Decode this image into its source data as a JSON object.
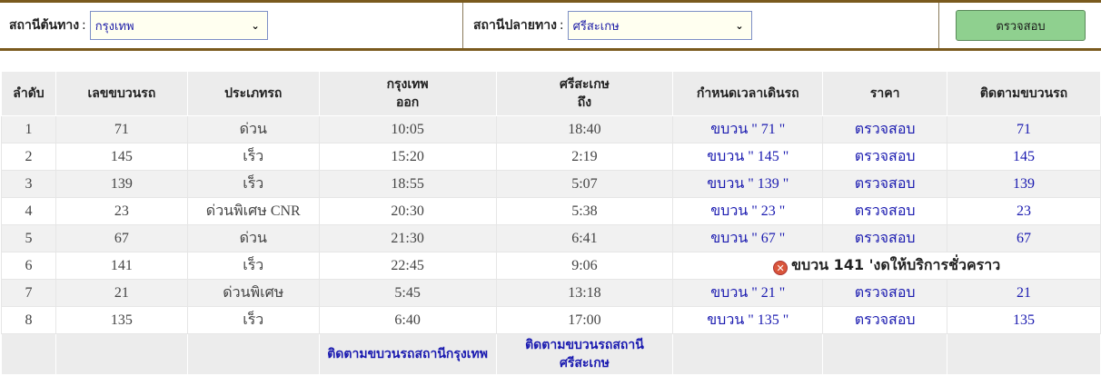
{
  "search": {
    "origin_label": "สถานีต้นทาง",
    "origin_value": "กรุงเทพ",
    "destination_label": "สถานีปลายทาง",
    "destination_value": "ศรีสะเกษ",
    "colon": ":",
    "check_button": "ตรวจสอบ"
  },
  "table": {
    "headers": {
      "seq": "ลำดับ",
      "train_no": "เลขขบวนรถ",
      "type": "ประเภทรถ",
      "depart_station": "กรุงเทพ",
      "depart_word": "ออก",
      "arrive_station": "ศรีสะเกษ",
      "arrive_word": "ถึง",
      "timetable": "กำหนดเวลาเดินรถ",
      "price": "ราคา",
      "track": "ติดตามขบวนรถ"
    },
    "rows": [
      {
        "seq": "1",
        "train_no": "71",
        "type": "ด่วน",
        "depart": "10:05",
        "arrive": "18:40",
        "timetable": "ขบวน \" 71 \"",
        "price": "ตรวจสอบ",
        "track": "71"
      },
      {
        "seq": "2",
        "train_no": "145",
        "type": "เร็ว",
        "depart": "15:20",
        "arrive": "2:19",
        "timetable": "ขบวน \" 145 \"",
        "price": "ตรวจสอบ",
        "track": "145"
      },
      {
        "seq": "3",
        "train_no": "139",
        "type": "เร็ว",
        "depart": "18:55",
        "arrive": "5:07",
        "timetable": "ขบวน \" 139 \"",
        "price": "ตรวจสอบ",
        "track": "139"
      },
      {
        "seq": "4",
        "train_no": "23",
        "type": "ด่วนพิเศษ CNR",
        "depart": "20:30",
        "arrive": "5:38",
        "timetable": "ขบวน \" 23 \"",
        "price": "ตรวจสอบ",
        "track": "23"
      },
      {
        "seq": "5",
        "train_no": "67",
        "type": "ด่วน",
        "depart": "21:30",
        "arrive": "6:41",
        "timetable": "ขบวน \" 67 \"",
        "price": "ตรวจสอบ",
        "track": "67"
      },
      {
        "seq": "6",
        "train_no": "141",
        "type": "เร็ว",
        "depart": "22:45",
        "arrive": "9:06",
        "cancelled": "ขบวน 141 'งดให้บริการชั่วคราว"
      },
      {
        "seq": "7",
        "train_no": "21",
        "type": "ด่วนพิเศษ",
        "depart": "5:45",
        "arrive": "13:18",
        "timetable": "ขบวน \" 21 \"",
        "price": "ตรวจสอบ",
        "track": "21"
      },
      {
        "seq": "8",
        "train_no": "135",
        "type": "เร็ว",
        "depart": "6:40",
        "arrive": "17:00",
        "timetable": "ขบวน \" 135 \"",
        "price": "ตรวจสอบ",
        "track": "135"
      }
    ],
    "footer": {
      "track_origin": "ติดตามขบวนรถสถานีกรุงเทพ",
      "track_destination_line1": "ติดตามขบวนรถสถานี",
      "track_destination_line2": "ศรีสะเกษ"
    }
  },
  "icons": {
    "cancel_icon": "x-circle-icon"
  },
  "colors": {
    "link": "#1a1ab0",
    "button_bg": "#8fd08f",
    "header_bg": "#ececec",
    "border_brown": "#7a5a1e",
    "cancel_icon": "#d9553b"
  }
}
